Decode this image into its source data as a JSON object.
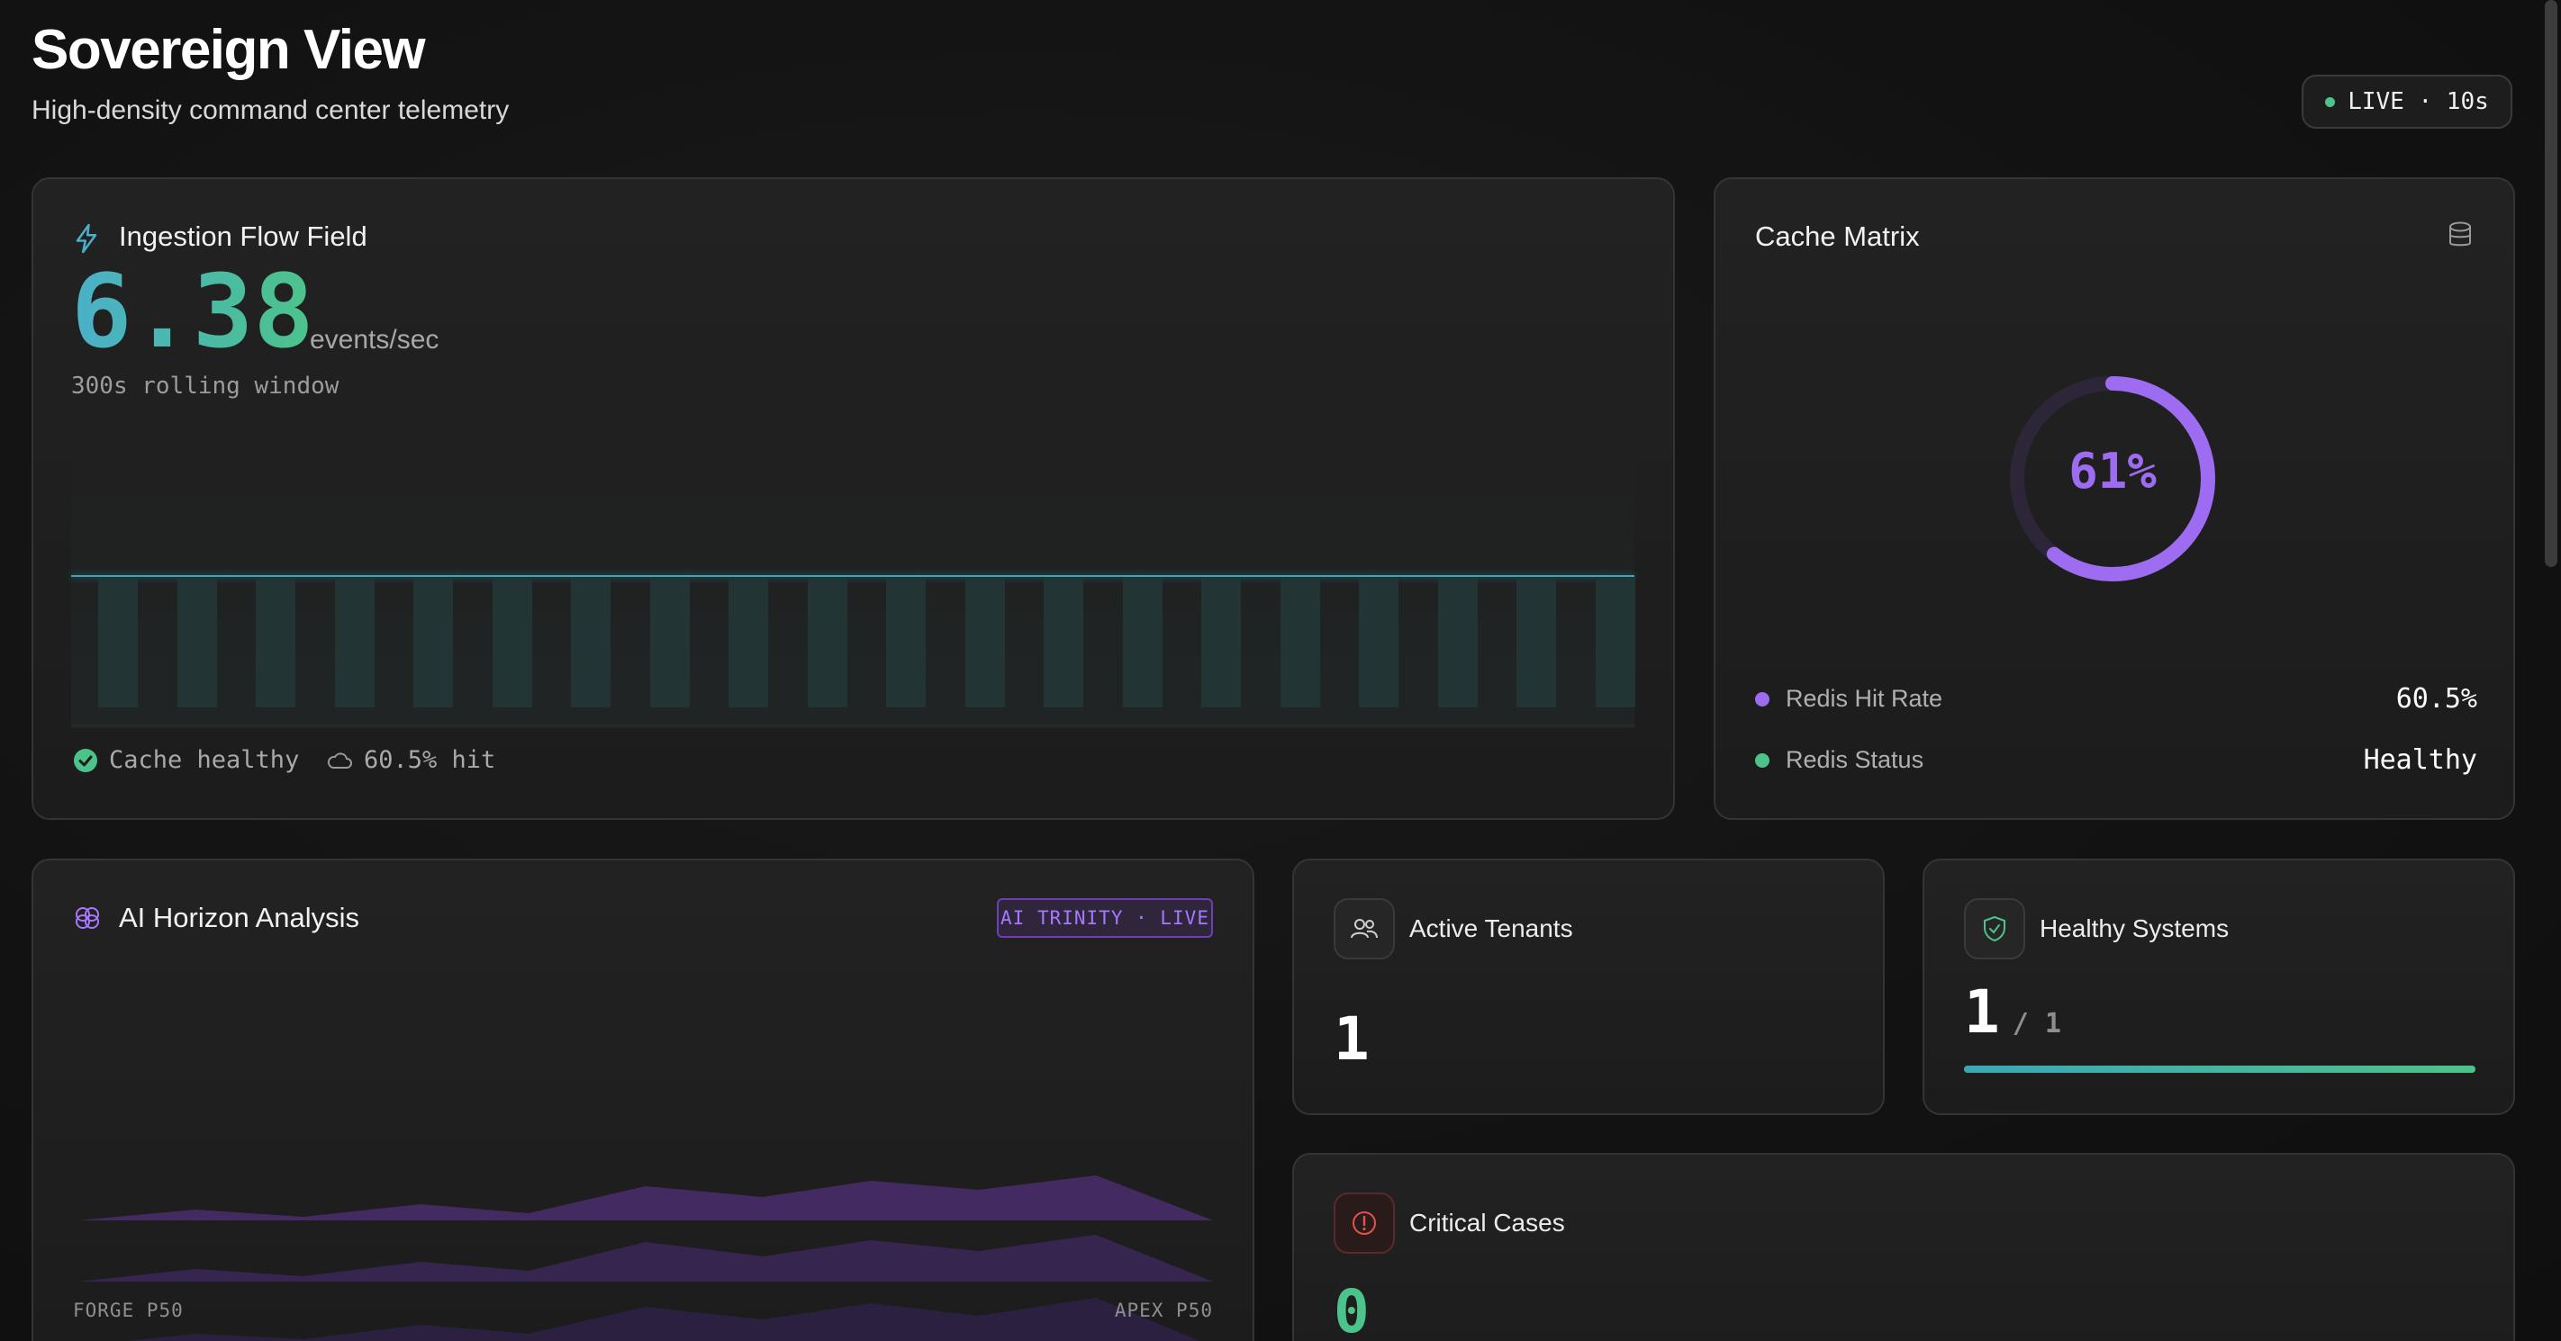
{
  "header": {
    "title": "Sovereign View",
    "subtitle": "High-density command center telemetry",
    "live_label": "LIVE · 10s",
    "live_color": "#4cc38a"
  },
  "ingestion": {
    "title": "Ingestion Flow Field",
    "icon": "lightning-icon",
    "value": "6.38",
    "unit": "events/sec",
    "window": "300s rolling window",
    "cache_status": "Cache healthy",
    "hit_rate": "60.5% hit",
    "accent_color": "#3aa7b6"
  },
  "cache": {
    "title": "Cache Matrix",
    "icon": "database-icon",
    "percent_label": "61%",
    "percent_value": 0.605,
    "accent_color": "#9d6cf0",
    "rows": [
      {
        "label": "Redis Hit Rate",
        "value": "60.5%",
        "color": "#9d6cf0"
      },
      {
        "label": "Redis Status",
        "value": "Healthy",
        "color": "#4cc38a"
      }
    ]
  },
  "ai": {
    "title": "AI Horizon Analysis",
    "icon": "brain-icon",
    "badge": "AI TRINITY · LIVE",
    "left_axis": "FORGE P50",
    "right_axis": "APEX P50",
    "accent_color": "#6e3fb5"
  },
  "tenants": {
    "title": "Active Tenants",
    "icon": "users-icon",
    "value": "1"
  },
  "healthy": {
    "title": "Healthy Systems",
    "icon": "shield-check-icon",
    "value": "1",
    "total": "/ 1",
    "progress": 1.0
  },
  "critical": {
    "title": "Critical Cases",
    "icon": "alert-circle-icon",
    "value": "0",
    "alert_color": "#e05252"
  }
}
